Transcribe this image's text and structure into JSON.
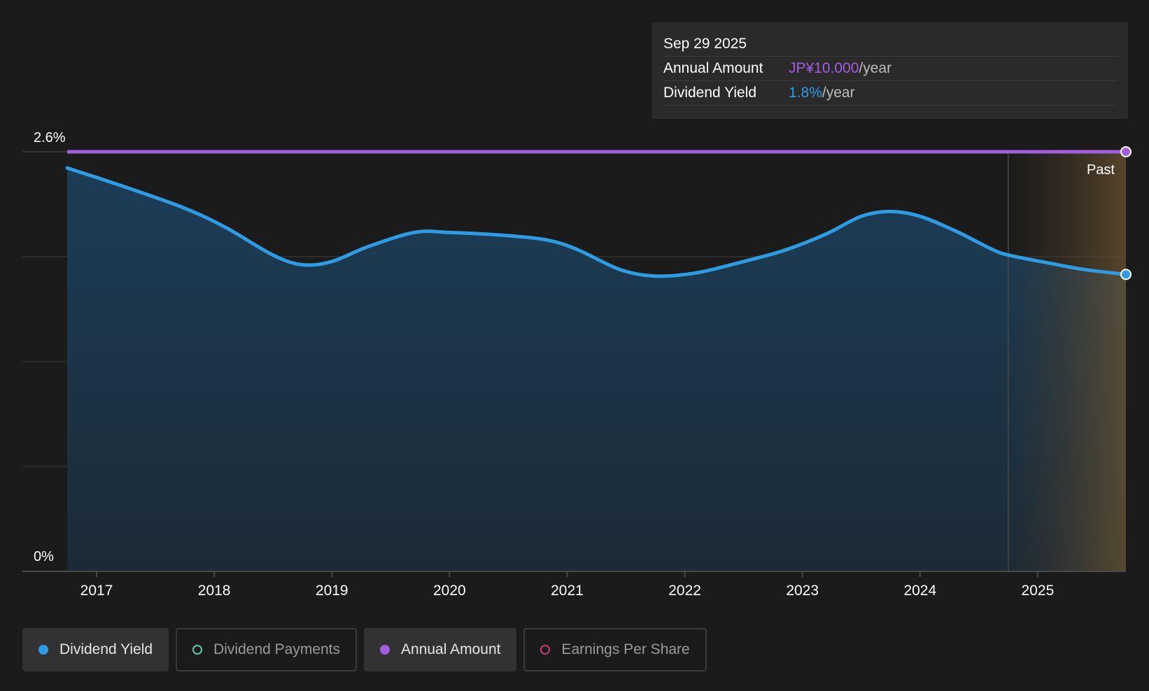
{
  "chart_data": {
    "type": "area",
    "y_axis_labels": [
      "2.6%",
      "0%"
    ],
    "ylim": [
      0,
      2.6
    ],
    "xlim": [
      2016.75,
      2025.75
    ],
    "x_ticks": [
      "2017",
      "2018",
      "2019",
      "2020",
      "2021",
      "2022",
      "2023",
      "2024",
      "2025"
    ],
    "x_tick_values": [
      2017,
      2018,
      2019,
      2020,
      2021,
      2022,
      2023,
      2024,
      2025
    ],
    "grid": true,
    "past_region": {
      "label": "Past",
      "start": 2024.75,
      "end": 2025.75
    },
    "series": [
      {
        "name": "Dividend Yield",
        "color": "#2f9be3",
        "x": [
          2016.75,
          2017.25,
          2017.75,
          2018.1,
          2018.5,
          2018.75,
          2019.0,
          2019.3,
          2019.7,
          2020.0,
          2020.5,
          2020.85,
          2021.1,
          2021.45,
          2021.75,
          2022.1,
          2022.5,
          2022.85,
          2023.2,
          2023.5,
          2023.75,
          2024.0,
          2024.3,
          2024.6,
          2024.75,
          2025.1,
          2025.4,
          2025.75
        ],
        "values": [
          2.5,
          2.38,
          2.25,
          2.13,
          1.96,
          1.9,
          1.92,
          2.01,
          2.1,
          2.1,
          2.08,
          2.05,
          1.99,
          1.87,
          1.83,
          1.85,
          1.92,
          1.99,
          2.09,
          2.2,
          2.23,
          2.2,
          2.11,
          2.0,
          1.96,
          1.91,
          1.87,
          1.84
        ]
      },
      {
        "name": "Annual Amount",
        "color": "#a35ee0",
        "x": [
          2016.75,
          2025.75
        ],
        "values": [
          2.6,
          2.6
        ]
      }
    ]
  },
  "tooltip": {
    "date": "Sep 29 2025",
    "rows": [
      {
        "label": "Annual Amount",
        "value": "JP¥10.000",
        "unit": "/year",
        "color": "#a35ee0"
      },
      {
        "label": "Dividend Yield",
        "value": "1.8%",
        "unit": "/year",
        "color": "#2f9be3"
      }
    ]
  },
  "legend": [
    {
      "label": "Dividend Yield",
      "color": "#2f9be3",
      "active": true
    },
    {
      "label": "Dividend Payments",
      "color": "#5fc7b8",
      "active": false
    },
    {
      "label": "Annual Amount",
      "color": "#a35ee0",
      "active": true
    },
    {
      "label": "Earnings Per Share",
      "color": "#c0407d",
      "active": false
    }
  ]
}
